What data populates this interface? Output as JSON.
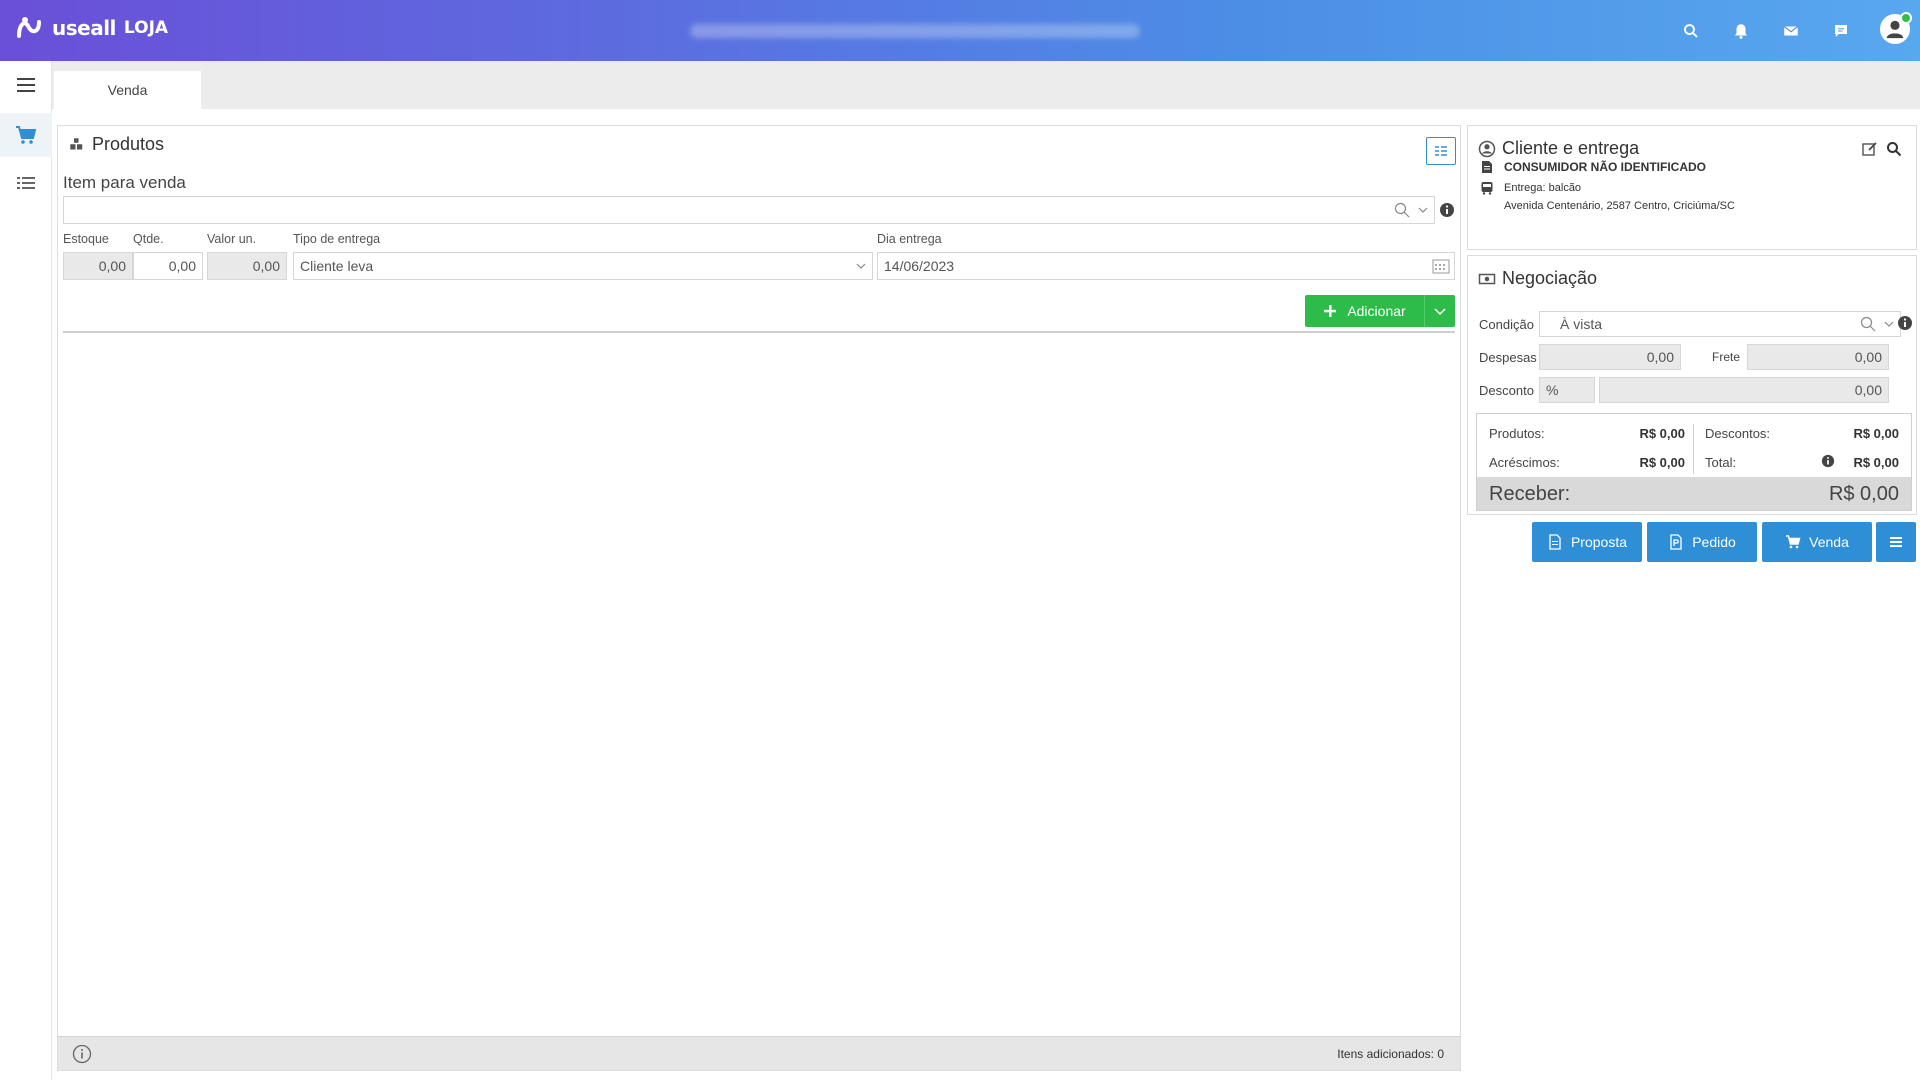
{
  "app": {
    "brand": "useall",
    "product": "LOJA",
    "accent": "#2e8fd6",
    "success": "#2dbc4a"
  },
  "header": {
    "icons": [
      "search-icon",
      "bell-icon",
      "mail-icon",
      "chat-icon"
    ]
  },
  "sidebar": {
    "items": [
      {
        "icon": "menu-icon"
      },
      {
        "icon": "cart-icon"
      },
      {
        "icon": "list-icon"
      }
    ]
  },
  "tabs": [
    {
      "label": "Venda"
    }
  ],
  "produtos": {
    "title": "Produtos",
    "subtitle": "Item para venda",
    "search_value": "",
    "labels": {
      "estoque": "Estoque",
      "qtde": "Qtde.",
      "valor_un": "Valor un.",
      "tipo_entrega": "Tipo de entrega",
      "dia_entrega": "Dia entrega"
    },
    "values": {
      "estoque": "0,00",
      "qtde": "0,00",
      "valor_un": "0,00",
      "tipo_entrega": "Cliente leva",
      "dia_entrega": "14/06/2023"
    },
    "add_label": "Adicionar",
    "footer_count": "Itens adicionados: 0"
  },
  "cliente": {
    "title": "Cliente e entrega",
    "name": "CONSUMIDOR NÃO IDENTIFICADO",
    "entrega": "Entrega: balcão",
    "endereco": "Avenida Centenário, 2587 Centro, Criciúma/SC"
  },
  "negociacao": {
    "title": "Negociação",
    "condicao_label": "Condição",
    "condicao_value": "À vista",
    "despesas_label": "Despesas",
    "despesas_value": "0,00",
    "frete_label": "Frete",
    "frete_value": "0,00",
    "desconto_label": "Desconto",
    "desconto_unit": "%",
    "desconto_value": "0,00",
    "summary": {
      "produtos_label": "Produtos:",
      "produtos_value": "R$ 0,00",
      "descontos_label": "Descontos:",
      "descontos_value": "R$ 0,00",
      "acrescimos_label": "Acréscimos:",
      "acrescimos_value": "R$ 0,00",
      "total_label": "Total:",
      "total_value": "R$ 0,00",
      "receber_label": "Receber:",
      "receber_value": "R$ 0,00"
    }
  },
  "actions": {
    "proposta": "Proposta",
    "pedido": "Pedido",
    "venda": "Venda"
  }
}
